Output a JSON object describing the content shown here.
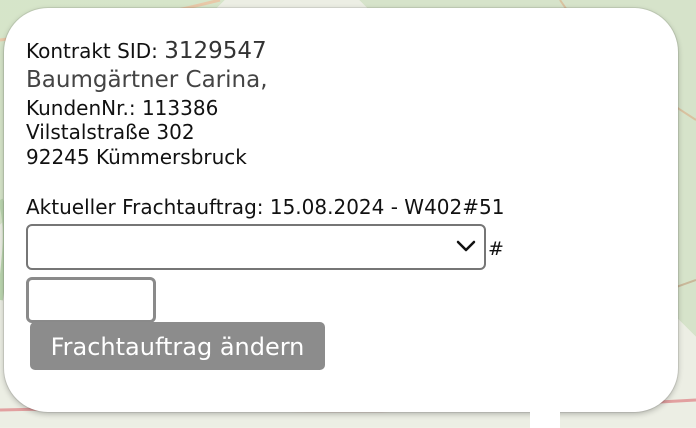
{
  "contract": {
    "label": "Kontrakt SID:",
    "sid": "3129547",
    "customer_name": "Baumgärtner Carina,",
    "customer_no_label": "KundenNr.:",
    "customer_no": "113386",
    "street": "Vilstalstraße 302",
    "city": "92245 Kümmersbruck"
  },
  "freight": {
    "label": "Aktueller Frachtauftrag:",
    "value": "15.08.2024 - W402#51",
    "select_value": "",
    "hash_label": "#",
    "number_value": "",
    "change_button": "Frachtauftrag ändern"
  },
  "icons": {
    "dropdown": "chevron-down-icon"
  }
}
